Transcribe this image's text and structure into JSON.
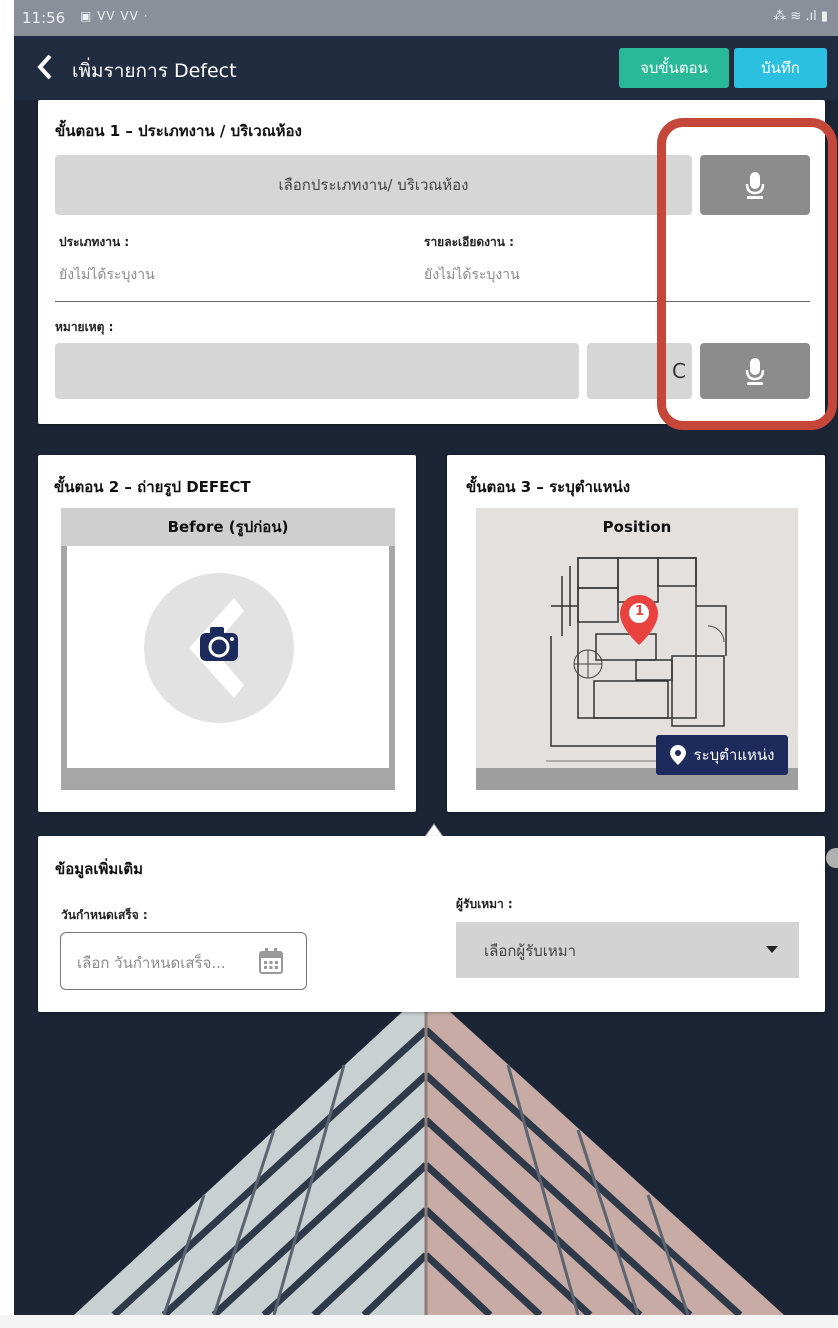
{
  "status_bar": {
    "time": "11:56",
    "left_icons": "▣ ᐯᐯ ᐯᐯ ·",
    "right_icons": "⁂ ≋ .ıl ▮"
  },
  "app_bar": {
    "back_icon": "chevron-left-icon",
    "title": "เพิ่มรายการ Defect",
    "end_step_label": "จบขั้นตอน",
    "save_label": "บันทึก"
  },
  "step1": {
    "title": "ขั้นตอน 1 – ประเภทงาน / บริเวณห้อง",
    "select_button_label": "เลือกประเภทงาน/ บริเวณห้อง",
    "work_type_label": "ประเภทงาน :",
    "work_type_value": "ยังไม่ได้ระบุงาน",
    "work_detail_label": "รายละเอียดงาน :",
    "work_detail_value": "ยังไม่ได้ระบุงาน",
    "remark_label": "หมายเหตุ :",
    "remark_value": "",
    "clear_button_glyph": "C"
  },
  "step2": {
    "title": "ขั้นตอน 2 – ถ่ายรูป DEFECT",
    "photo_header": "Before (รูปก่อน)"
  },
  "step3": {
    "title": "ขั้นตอน 3 – ระบุตำแหน่ง",
    "map_header": "Position",
    "pin_number": "1",
    "locate_button_label": "ระบุตำแหน่ง"
  },
  "extra": {
    "title": "ข้อมูลเพิ่มเติม",
    "due_date_label": "วันกำหนดเสร็จ :",
    "due_date_placeholder": "เลือก วันกำหนดเสร็จ...",
    "contractor_label": "ผู้รับเหมา :",
    "contractor_value": "เลือกผู้รับเหมา"
  },
  "colors": {
    "app_bar": "#222c40",
    "end_step_button": "#29b898",
    "save_button": "#2bbfe0",
    "mic_button": "#8c8c8c",
    "highlight": "#c4473a",
    "locate_button": "#1d2a5c",
    "map_pin": "#e9423f"
  }
}
